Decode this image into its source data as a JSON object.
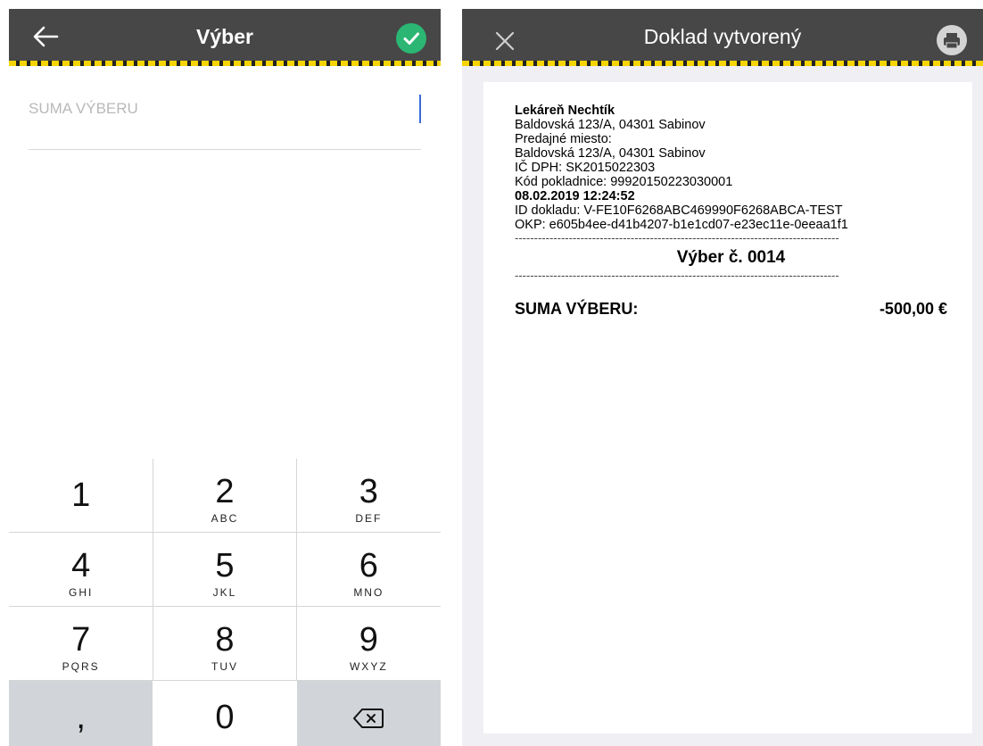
{
  "left": {
    "title": "Výber",
    "back_icon": "arrow-left-icon",
    "confirm_icon": "check-circle-icon",
    "input_placeholder": "SUMA VÝBERU",
    "input_value": "",
    "keys": [
      [
        {
          "num": "1",
          "letters": ""
        },
        {
          "num": "2",
          "letters": "ABC"
        },
        {
          "num": "3",
          "letters": "DEF"
        }
      ],
      [
        {
          "num": "4",
          "letters": "GHI"
        },
        {
          "num": "5",
          "letters": "JKL"
        },
        {
          "num": "6",
          "letters": "MNO"
        }
      ],
      [
        {
          "num": "7",
          "letters": "PQRS"
        },
        {
          "num": "8",
          "letters": "TUV"
        },
        {
          "num": "9",
          "letters": "WXYZ"
        }
      ],
      [
        {
          "num": ",",
          "letters": ""
        },
        {
          "num": "0",
          "letters": ""
        },
        {
          "num": "",
          "letters": ""
        }
      ]
    ],
    "backspace_icon": "backspace-icon",
    "colors": {
      "topbar": "#474747",
      "accent_check": "#2bb673",
      "stripe": "#f5d400"
    }
  },
  "right": {
    "title": "Doklad vytvorený",
    "close_icon": "close-icon",
    "print_icon": "printer-icon",
    "receipt": {
      "shop_name": "Lekáreň Nechtík",
      "address": "Baldovská 123/A, 04301 Sabinov",
      "place_label": "Predajné miesto:",
      "place_address": "Baldovská 123/A, 04301 Sabinov",
      "vat": "IČ DPH: SK2015022303",
      "cash_code": "Kód pokladnice: 99920150223030001",
      "datetime": "08.02.2019 12:24:52",
      "doc_id": "ID dokladu: V-FE10F6268ABC469990F6268ABCA-TEST",
      "okp": "OKP: e605b4ee-d41b4207-b1e1cd07-e23ec11e-0eeaa1f1",
      "dashes": "------------------------------------------------------------------------------------",
      "doc_title": "Výber č. 0014",
      "sum_label": "SUMA VÝBERU:",
      "sum_value": "-500,00 €"
    }
  }
}
